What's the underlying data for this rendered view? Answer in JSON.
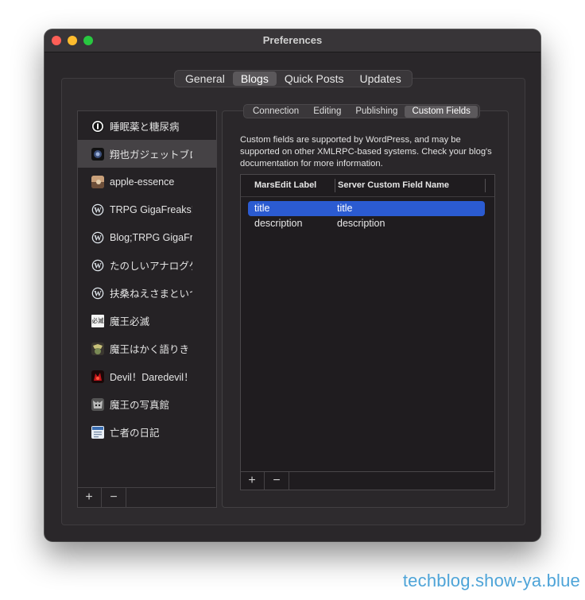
{
  "window": {
    "title": "Preferences"
  },
  "top_tabs": [
    {
      "label": "General",
      "active": false
    },
    {
      "label": "Blogs",
      "active": true
    },
    {
      "label": "Quick Posts",
      "active": false
    },
    {
      "label": "Updates",
      "active": false
    }
  ],
  "blogs": [
    {
      "label": "睡眠薬と糖尿病",
      "icon": "info-icon",
      "selected": false
    },
    {
      "label": "翔也ガジェットブログ",
      "icon": "gadget-blog-icon",
      "selected": true
    },
    {
      "label": "apple-essence",
      "icon": "apple-essence-icon",
      "selected": false
    },
    {
      "label": "TRPG GigaFreaks!",
      "icon": "wordpress-icon",
      "selected": false
    },
    {
      "label": "Blog;TRPG GigaFreaks",
      "icon": "wordpress-icon",
      "selected": false
    },
    {
      "label": "たのしいアナログゲーム",
      "icon": "wordpress-icon",
      "selected": false
    },
    {
      "label": "扶桑ねえさまといつまでも",
      "icon": "wordpress-icon",
      "selected": false
    },
    {
      "label": "魔王必滅",
      "icon": "maou-hitsumetsu-icon",
      "icon_text": "必滅",
      "selected": false
    },
    {
      "label": "魔王はかく語りき",
      "icon": "maou-kataraki-icon",
      "selected": false
    },
    {
      "label": "Devil！Daredevil！",
      "icon": "devil-icon",
      "selected": false
    },
    {
      "label": "魔王の写真館",
      "icon": "photo-studio-icon",
      "selected": false
    },
    {
      "label": "亡者の日記",
      "icon": "diary-icon",
      "selected": false
    }
  ],
  "list_footer": {
    "add": "+",
    "remove": "−"
  },
  "sub_tabs": [
    {
      "label": "Connection",
      "active": false
    },
    {
      "label": "Editing",
      "active": false
    },
    {
      "label": "Publishing",
      "active": false
    },
    {
      "label": "Custom Fields",
      "active": true
    }
  ],
  "custom_fields": {
    "description": "Custom fields are supported by WordPress, and may be supported on other XMLRPC-based systems. Check your blog's documentation for more information.",
    "columns": [
      "MarsEdit Label",
      "Server Custom Field Name"
    ],
    "rows": [
      {
        "label": "title",
        "field": "title",
        "selected": true
      },
      {
        "label": "description",
        "field": "description",
        "selected": false
      }
    ]
  },
  "table_footer": {
    "add": "+",
    "remove": "−"
  },
  "watermark": "techblog.show-ya.blue",
  "colors": {
    "selection": "#2b5bd1",
    "wordpress": "#dfe6ec"
  }
}
